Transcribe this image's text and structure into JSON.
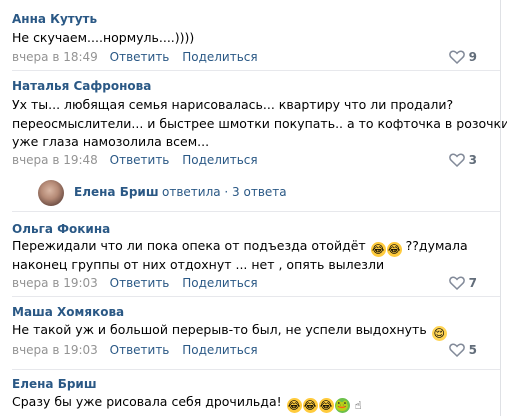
{
  "comments": [
    {
      "author": "Анна Кутуть",
      "lines": [
        "Не скучаем....нормуль....))))"
      ],
      "time": "вчера в 18:49",
      "reply_label": "Ответить",
      "share_label": "Поделиться",
      "likes": "9"
    },
    {
      "author": "Наталья Сафронова",
      "lines": [
        "Ух ты... любящая семья нарисовалась... квартиру что ли продали?",
        "переосмыслители... и быстрее шмотки покупать.. а то кофточка в розочки",
        "уже глаза намозолила всем..."
      ],
      "time": "вчера в 19:48",
      "reply_label": "Ответить",
      "share_label": "Поделиться",
      "likes": "3"
    },
    {
      "author": "Ольга Фокина",
      "lines": [
        "Пережидали что ли пока опека от подъезда отойдёт",
        "??думала",
        "наконец группы от них отдохнут ... нет , опять вылезли"
      ],
      "time": "вчера в 19:03",
      "reply_label": "Ответить",
      "share_label": "Поделиться",
      "likes": "7"
    },
    {
      "author": "Маша Хомякова",
      "lines": [
        "Не такой уж и большой перерыв-то был, не успели выдохнуть"
      ],
      "time": "вчера в 19:03",
      "reply_label": "Ответить",
      "share_label": "Поделиться",
      "likes": "5"
    },
    {
      "author": "Елена Бриш",
      "lines": [
        "Сразу бы уже рисовала себя дрочильда!"
      ]
    }
  ],
  "thread": {
    "name": "Елена Бриш",
    "replied": "ответила · 3 ответа"
  },
  "colors": {
    "link": "#2a5885",
    "meta": "#939393",
    "like": "#626d7a"
  },
  "icons": [
    "heart-icon",
    "laughing-emoji",
    "frog-emoji",
    "relieved-emoji",
    "hand-emoji"
  ]
}
